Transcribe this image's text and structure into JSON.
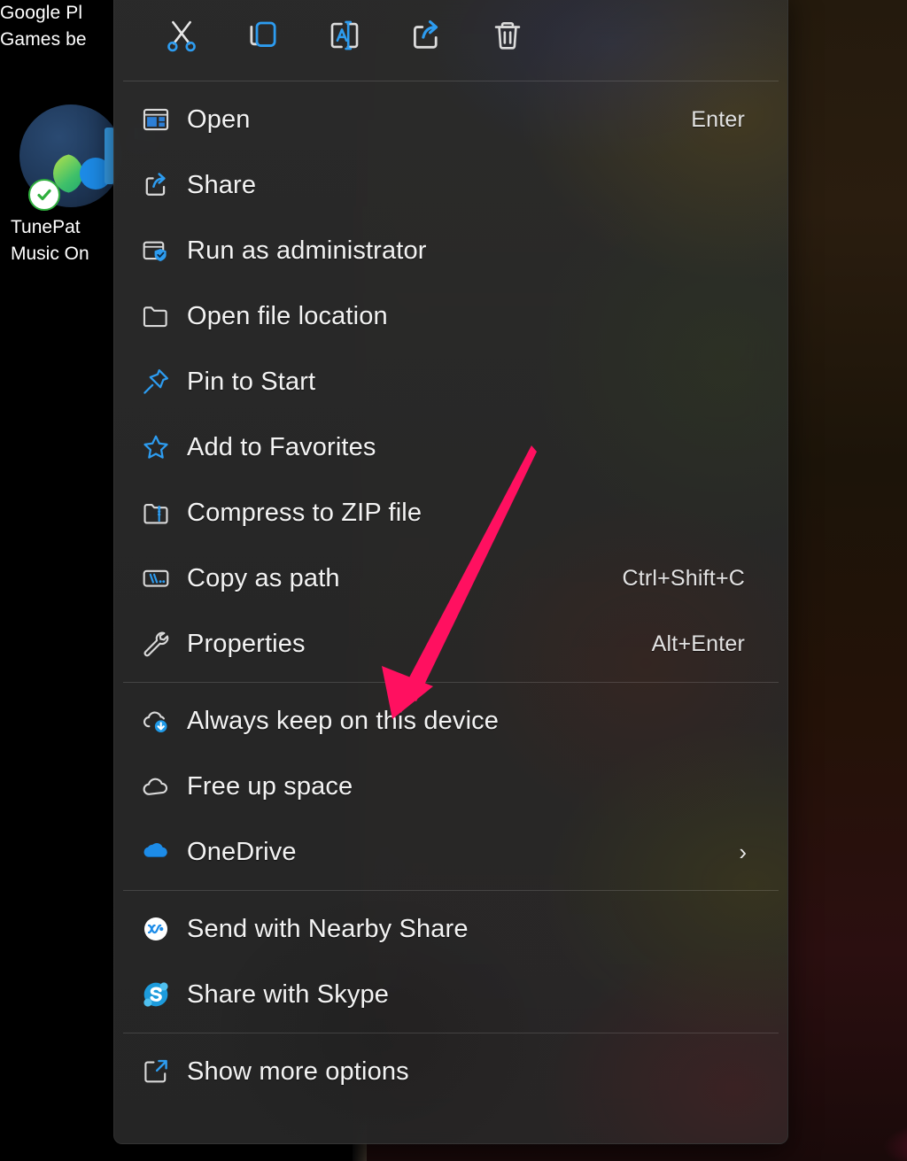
{
  "theme": {
    "menu_bg": "#2b2b2b",
    "text_color": "#f3f3f3",
    "accent_blue": "#2d9cf0",
    "annotation_color": "#ff1060",
    "separator": "rgba(255,255,255,0.14)"
  },
  "desktop": {
    "icons": [
      {
        "name": "google-play-games",
        "label_line1": "Google Pl",
        "label_line2": "Games be"
      },
      {
        "name": "tunepat-music-one",
        "label_line1": "TunePat",
        "label_line2": "Music On",
        "badge": "sync-ok-check"
      }
    ]
  },
  "context_menu": {
    "toolbar": [
      {
        "icon": "cut-icon",
        "label": "Cut"
      },
      {
        "icon": "copy-icon",
        "label": "Copy"
      },
      {
        "icon": "rename-icon",
        "label": "Rename"
      },
      {
        "icon": "share-icon",
        "label": "Share"
      },
      {
        "icon": "delete-icon",
        "label": "Delete"
      }
    ],
    "groups": [
      {
        "items": [
          {
            "icon": "open-window-icon",
            "label": "Open",
            "accel": "Enter"
          },
          {
            "icon": "share-icon",
            "label": "Share",
            "accel": ""
          },
          {
            "icon": "shield-admin-icon",
            "label": "Run as administrator",
            "accel": ""
          },
          {
            "icon": "folder-icon",
            "label": "Open file location",
            "accel": ""
          },
          {
            "icon": "pin-icon",
            "label": "Pin to Start",
            "accel": ""
          },
          {
            "icon": "star-icon",
            "label": "Add to Favorites",
            "accel": ""
          },
          {
            "icon": "zip-icon",
            "label": "Compress to ZIP file",
            "accel": ""
          },
          {
            "icon": "copy-path-icon",
            "label": "Copy as path",
            "accel": "Ctrl+Shift+C"
          },
          {
            "icon": "wrench-icon",
            "label": "Properties",
            "accel": "Alt+Enter"
          }
        ]
      },
      {
        "items": [
          {
            "icon": "cloud-download-icon",
            "label": "Always keep on this device",
            "accel": ""
          },
          {
            "icon": "cloud-icon",
            "label": "Free up space",
            "accel": ""
          },
          {
            "icon": "onedrive-icon",
            "label": "OneDrive",
            "accel": "",
            "submenu": true
          }
        ]
      },
      {
        "items": [
          {
            "icon": "nearby-share-icon",
            "label": "Send with Nearby Share",
            "accel": ""
          },
          {
            "icon": "skype-icon",
            "label": "Share with Skype",
            "accel": ""
          }
        ]
      },
      {
        "items": [
          {
            "icon": "show-more-icon",
            "label": "Show more options",
            "accel": ""
          }
        ]
      }
    ],
    "submenu_chevron": "›"
  },
  "annotation": {
    "type": "arrow",
    "target_label": "Always keep on this device",
    "color": "#ff1060"
  }
}
